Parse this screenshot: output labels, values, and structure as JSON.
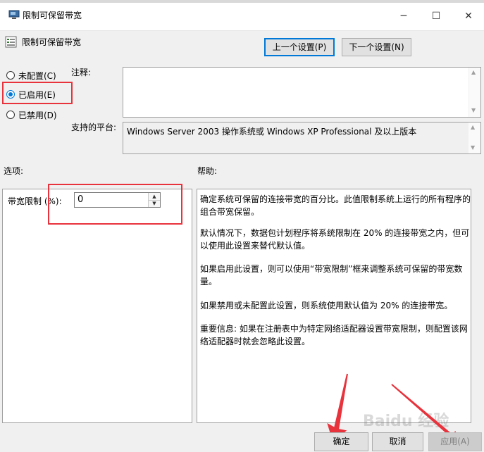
{
  "window": {
    "title": "限制可保留带宽",
    "minimize_glyph": "─",
    "maximize_glyph": "☐",
    "close_glyph": "✕"
  },
  "header": {
    "policy_name": "限制可保留带宽",
    "prev_label": "上一个设置(P)",
    "next_label": "下一个设置(N)"
  },
  "state": {
    "options": [
      {
        "label": "未配置(C)",
        "selected": false
      },
      {
        "label": "已启用(E)",
        "selected": true
      },
      {
        "label": "已禁用(D)",
        "selected": false
      }
    ]
  },
  "comment": {
    "label": "注释:",
    "value": ""
  },
  "platform": {
    "label": "支持的平台:",
    "value": "Windows Server 2003 操作系统或 Windows XP Professional 及以上版本"
  },
  "options_section": {
    "label": "选项:",
    "bandwidth_label": "带宽限制 (%):",
    "bandwidth_value": "0"
  },
  "help_section": {
    "label": "帮助:",
    "paragraphs": [
      "确定系统可保留的连接带宽的百分比。此值限制系统上运行的所有程序的组合带宽保留。",
      "默认情况下，数据包计划程序将系统限制在 20% 的连接带宽之内，但可以使用此设置来替代默认值。",
      "如果启用此设置，则可以使用“带宽限制”框来调整系统可保留的带宽数量。",
      "如果禁用或未配置此设置，则系统使用默认值为 20% 的连接带宽。",
      "重要信息: 如果在注册表中为特定网络适配器设置带宽限制，则配置该网络适配器时就会忽略此设置。"
    ]
  },
  "footer": {
    "ok_label": "确定",
    "cancel_label": "取消",
    "apply_label": "应用(A)"
  },
  "watermark": "Baidu 经验",
  "colors": {
    "accent": "#0078d7",
    "annotation_red": "#e8323c"
  }
}
